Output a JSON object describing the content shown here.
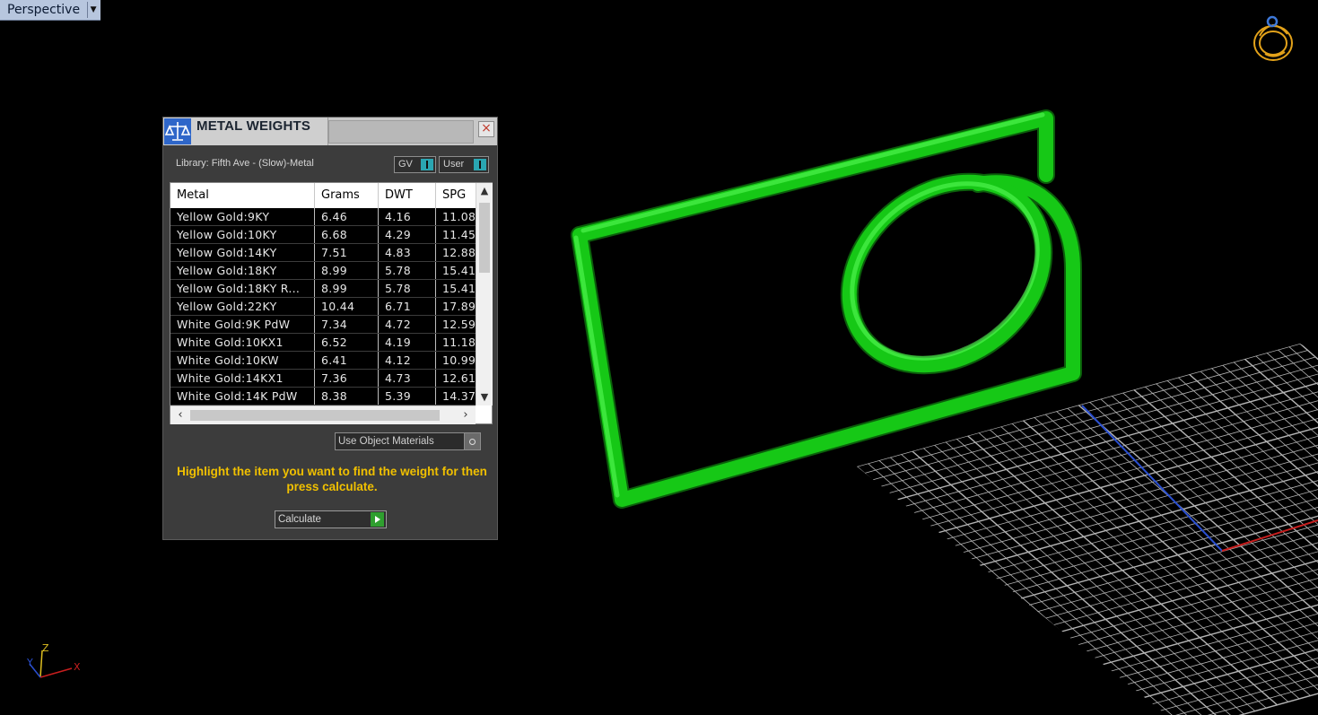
{
  "viewport": {
    "name": "Perspective"
  },
  "panel": {
    "title": "METAL WEIGHTS",
    "close_glyph": "×",
    "library_label": "Library: Fifth Ave - (Slow)-Metal",
    "toggle_gv": "GV",
    "toggle_user": "User",
    "columns": [
      "Metal",
      "Grams",
      "DWT",
      "SPG"
    ],
    "rows": [
      {
        "metal": "Yellow Gold:9KY",
        "grams": "6.46",
        "dwt": "4.16",
        "spg": "11.08"
      },
      {
        "metal": "Yellow Gold:10KY",
        "grams": "6.68",
        "dwt": "4.29",
        "spg": "11.45"
      },
      {
        "metal": "Yellow Gold:14KY",
        "grams": "7.51",
        "dwt": "4.83",
        "spg": "12.88"
      },
      {
        "metal": "Yellow Gold:18KY",
        "grams": "8.99",
        "dwt": "5.78",
        "spg": "15.41"
      },
      {
        "metal": "Yellow Gold:18KY R...",
        "grams": "8.99",
        "dwt": "5.78",
        "spg": "15.41"
      },
      {
        "metal": "Yellow Gold:22KY",
        "grams": "10.44",
        "dwt": "6.71",
        "spg": "17.89"
      },
      {
        "metal": "White Gold:9K PdW",
        "grams": "7.34",
        "dwt": "4.72",
        "spg": "12.59"
      },
      {
        "metal": "White Gold:10KX1",
        "grams": "6.52",
        "dwt": "4.19",
        "spg": "11.18"
      },
      {
        "metal": "White Gold:10KW",
        "grams": "6.41",
        "dwt": "4.12",
        "spg": "10.99"
      },
      {
        "metal": "White Gold:14KX1",
        "grams": "7.36",
        "dwt": "4.73",
        "spg": "12.61"
      },
      {
        "metal": "White Gold:14K PdW",
        "grams": "8.38",
        "dwt": "5.39",
        "spg": "14.37"
      }
    ],
    "use_object_materials": "Use Object Materials",
    "hint": "Highlight the item you want to find the weight for then press calculate.",
    "calculate": "Calculate"
  },
  "axes": {
    "x": "X",
    "y": "Y",
    "z": "Z"
  },
  "colors": {
    "model": "#18d018",
    "grid": "#bdbdbd",
    "axis_x": "#c81e1e",
    "axis_y": "#2a4fd0",
    "hint": "#f0c000"
  }
}
